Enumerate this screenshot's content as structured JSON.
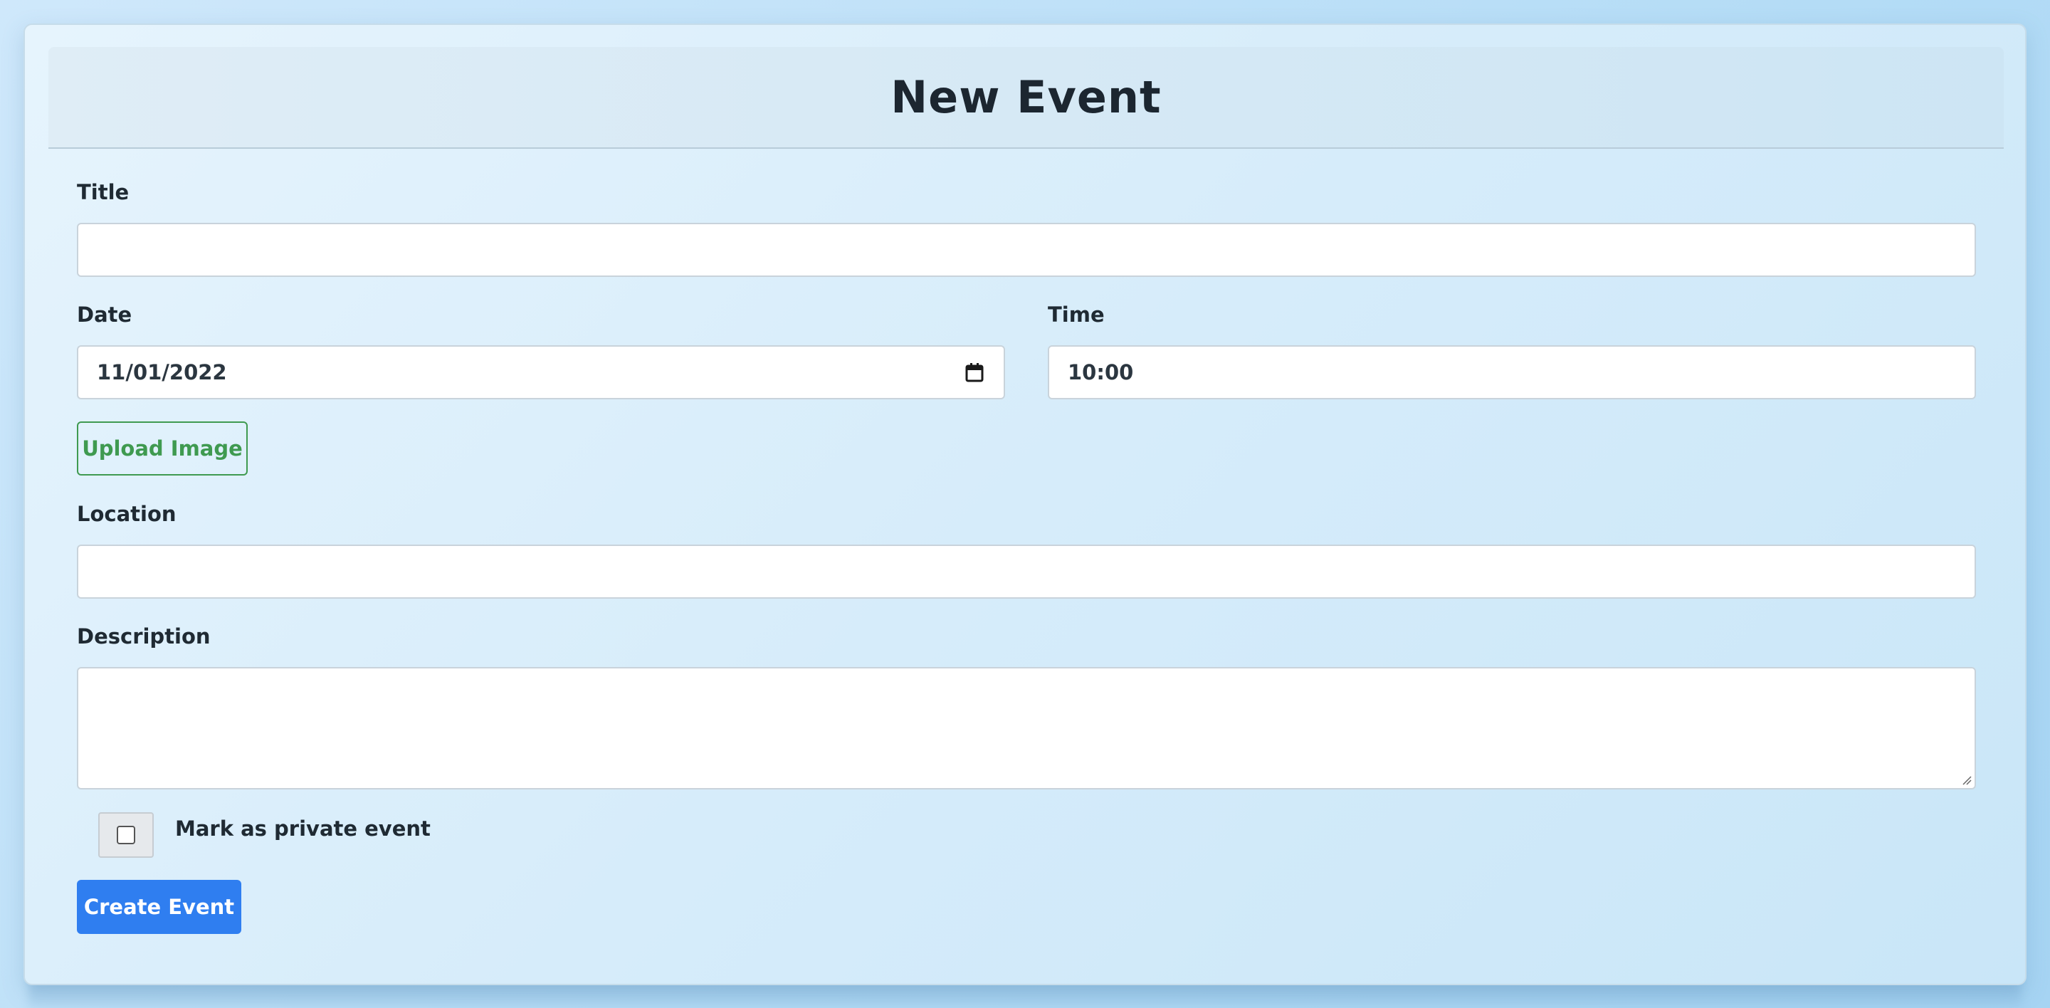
{
  "header": {
    "title": "New Event"
  },
  "form": {
    "title": {
      "label": "Title",
      "value": ""
    },
    "date": {
      "label": "Date",
      "value": "11/01/2022"
    },
    "time": {
      "label": "Time",
      "value": "10:00"
    },
    "upload_label": "Upload Image",
    "location": {
      "label": "Location",
      "value": ""
    },
    "description": {
      "label": "Description",
      "value": ""
    },
    "private": {
      "label": "Mark as private event",
      "checked": false
    },
    "submit_label": "Create Event"
  },
  "icons": {
    "date_picker": "calendar-icon"
  },
  "colors": {
    "primary": "#2f7ef0",
    "success": "#3f9a50",
    "text": "#1f2a33"
  }
}
